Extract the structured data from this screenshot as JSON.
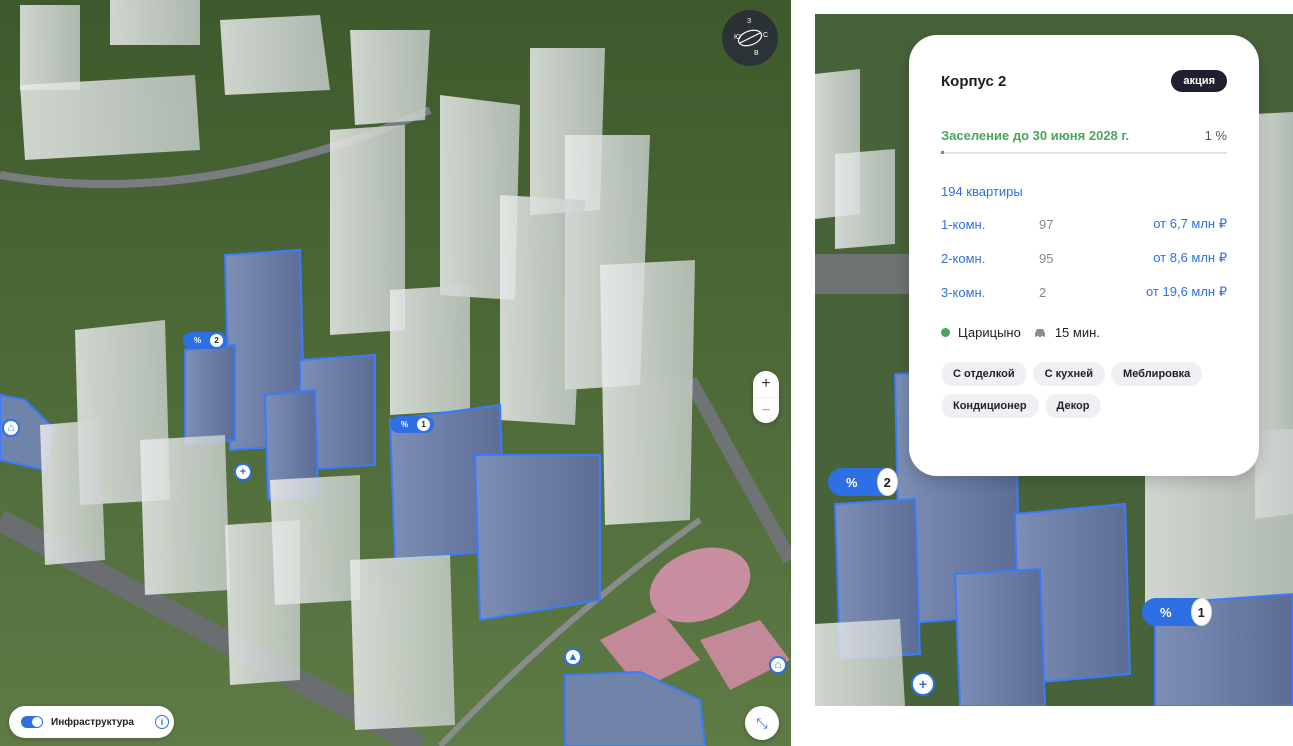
{
  "map": {
    "compass": {
      "n": "С",
      "s": "Ю",
      "e": "В",
      "w": "З"
    },
    "zoom": {
      "in": "+",
      "out": "−"
    },
    "infrastructure": {
      "label": "Инфраструктура",
      "enabled": true,
      "info": "i"
    },
    "promo_pins": [
      {
        "symbol": "%",
        "number": "2"
      },
      {
        "symbol": "%",
        "number": "1"
      }
    ]
  },
  "card": {
    "title": "Корпус 2",
    "badge": "акция",
    "settlement": {
      "text": "Заселение до 30 июня 2028 г.",
      "percent_label": "1 %",
      "percent": 1
    },
    "apartments_total": "194 квартиры",
    "rows": [
      {
        "type": "1-комн.",
        "count": "97",
        "price": "от 6,7 млн ₽"
      },
      {
        "type": "2-комн.",
        "count": "95",
        "price": "от 8,6 млн ₽"
      },
      {
        "type": "3-комн.",
        "count": "2",
        "price": "от 19,6 млн ₽"
      }
    ],
    "metro": {
      "station": "Царицыно",
      "time": "15 мин."
    },
    "tags": [
      "С отделкой",
      "С кухней",
      "Меблировка",
      "Кондиционер",
      "Декор"
    ]
  },
  "colors": {
    "accent": "#2f6fe4",
    "green": "#4ba55b",
    "dark_badge": "#1e2030"
  }
}
